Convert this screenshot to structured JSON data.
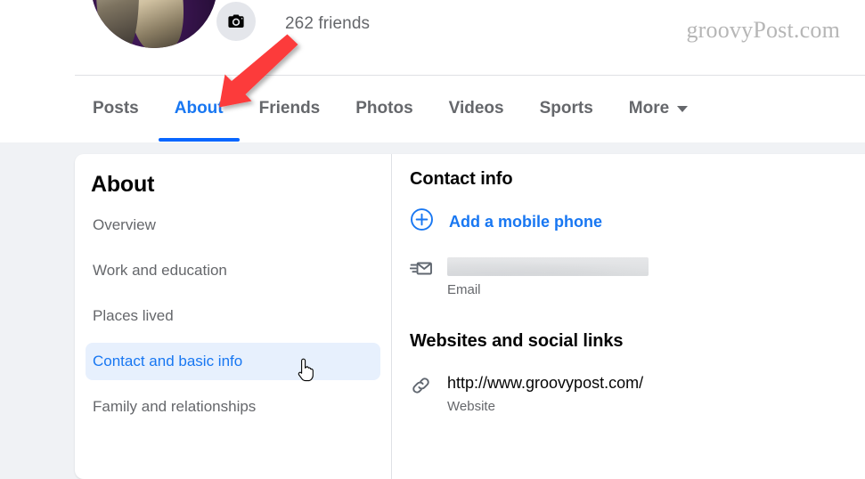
{
  "profile": {
    "friends_count_text": "262 friends",
    "camera_icon": "camera-icon",
    "avatar_alt": "profile-avatar"
  },
  "watermark": {
    "text": "groovyPost.com"
  },
  "tabs": [
    {
      "label": "Posts",
      "active": false,
      "caret": false
    },
    {
      "label": "About",
      "active": true,
      "caret": false
    },
    {
      "label": "Friends",
      "active": false,
      "caret": false
    },
    {
      "label": "Photos",
      "active": false,
      "caret": false
    },
    {
      "label": "Videos",
      "active": false,
      "caret": false
    },
    {
      "label": "Sports",
      "active": false,
      "caret": false
    },
    {
      "label": "More",
      "active": false,
      "caret": true
    }
  ],
  "about": {
    "heading": "About",
    "items": [
      {
        "label": "Overview",
        "selected": false
      },
      {
        "label": "Work and education",
        "selected": false
      },
      {
        "label": "Places lived",
        "selected": false
      },
      {
        "label": "Contact and basic info",
        "selected": true
      },
      {
        "label": "Family and relationships",
        "selected": false
      }
    ]
  },
  "contact": {
    "section_title": "Contact info",
    "add_phone_label": "Add a mobile phone",
    "add_phone_icon": "plus-circle-icon",
    "email": {
      "icon": "email-icon",
      "value": "",
      "value_redacted": true,
      "sub_label": "Email"
    }
  },
  "websites": {
    "section_title": "Websites and social links",
    "entry": {
      "icon": "link-icon",
      "url": "http://www.groovypost.com/",
      "sub_label": "Website"
    }
  },
  "annotations": {
    "arrow": {
      "name": "red-arrow-annotation",
      "color": "#fc3b3b",
      "points_to": "About"
    },
    "cursor": {
      "name": "hand-cursor",
      "over": "Contact and basic info"
    }
  },
  "colors": {
    "brand_blue": "#1877f2",
    "active_underline": "#0866ff",
    "page_bg": "#f0f2f5",
    "card_bg": "#ffffff",
    "text_primary": "#050505",
    "text_secondary": "#65676b",
    "selected_bg": "#e7f0fd",
    "annotation_red": "#fc3b3b"
  }
}
